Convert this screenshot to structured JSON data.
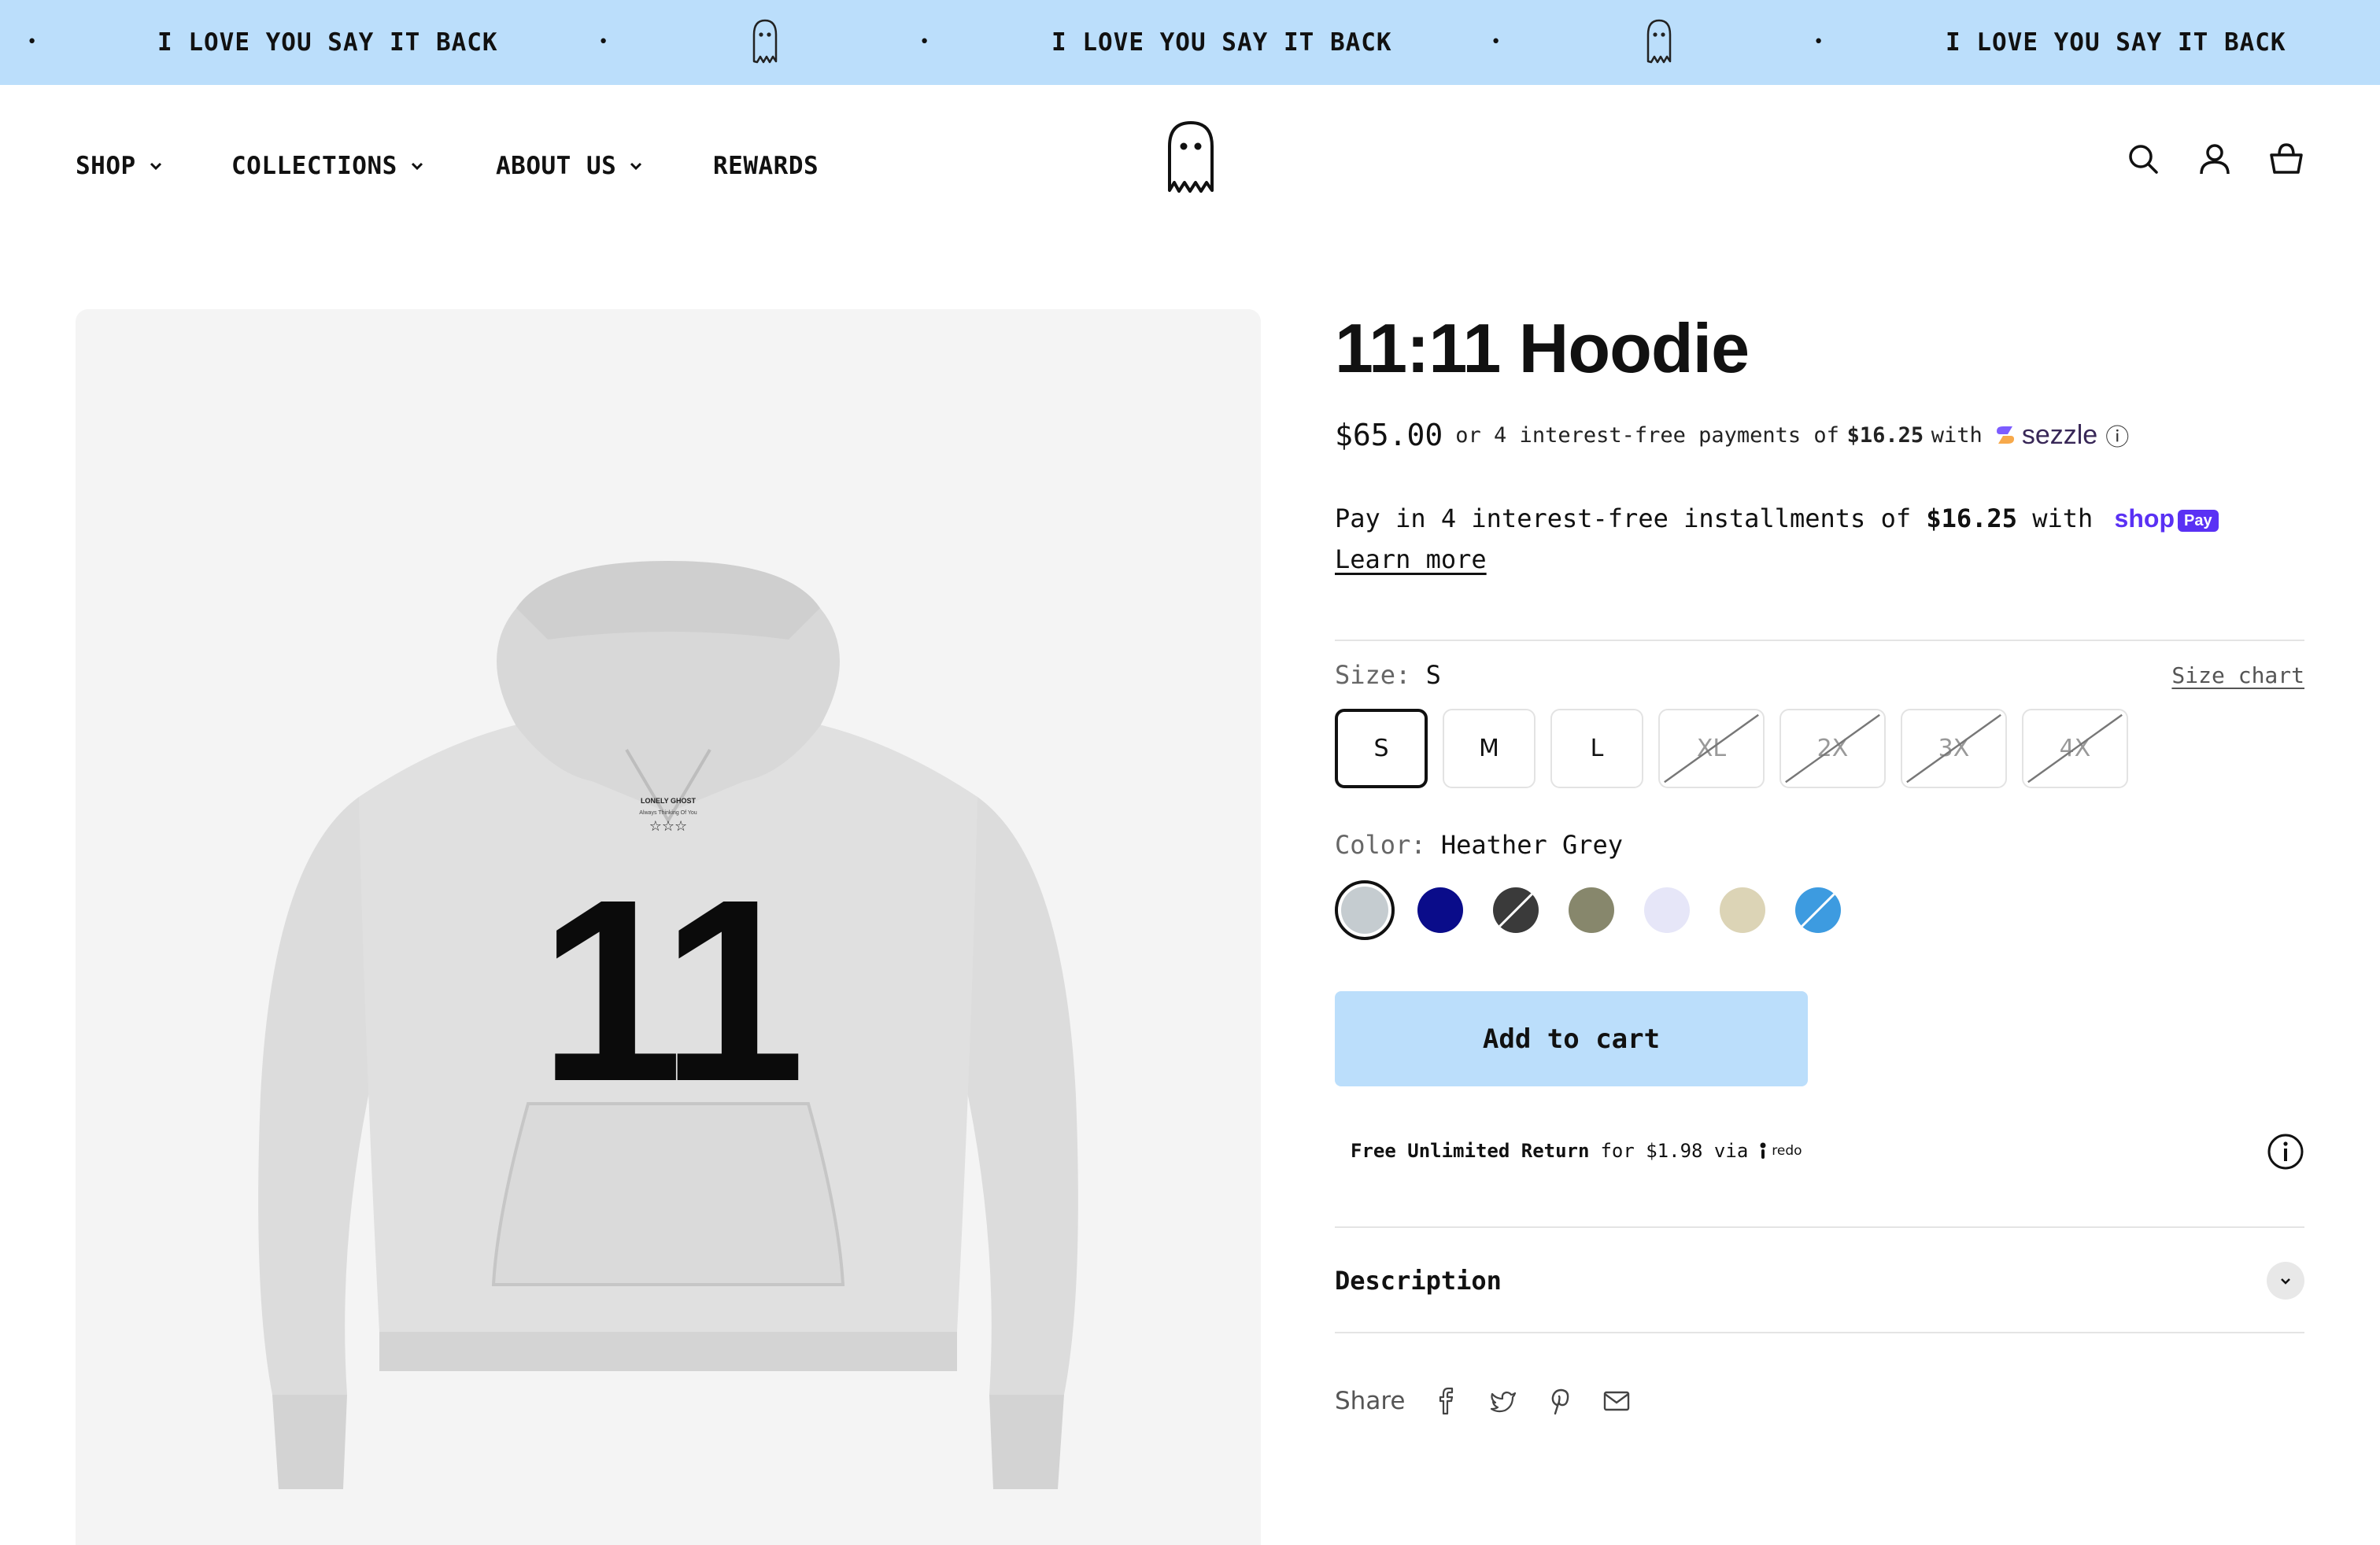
{
  "announcement": {
    "message": "I LOVE YOU SAY IT BACK",
    "separator": "•",
    "background": "#bbdefb"
  },
  "nav": {
    "items": [
      {
        "label": "SHOP",
        "has_dropdown": true
      },
      {
        "label": "COLLECTIONS",
        "has_dropdown": true
      },
      {
        "label": "ABOUT US",
        "has_dropdown": true
      },
      {
        "label": "REWARDS",
        "has_dropdown": false
      }
    ],
    "icons": [
      "ghost-logo-icon",
      "search-icon",
      "account-icon",
      "cart-icon"
    ]
  },
  "product": {
    "title": "11:11 Hoodie",
    "price": "$65.00",
    "image_print": {
      "brand": "LONELY GHOST",
      "tagline": "Always Thinking Of You",
      "number": "11"
    }
  },
  "sezzle": {
    "prefix": "or 4 interest-free payments of",
    "amount": "$16.25",
    "suffix": "with",
    "brand": "sezzle",
    "info_symbol": "ⓘ"
  },
  "shop_pay": {
    "prefix": "Pay in 4 interest-free installments of",
    "amount": "$16.25",
    "suffix": "with",
    "brand_word": "shop",
    "badge": "Pay",
    "learn_more": "Learn more"
  },
  "size": {
    "label": "Size:",
    "selected": "S",
    "size_chart": "Size chart",
    "options": [
      {
        "label": "S",
        "available": true,
        "selected": true
      },
      {
        "label": "M",
        "available": true,
        "selected": false
      },
      {
        "label": "L",
        "available": true,
        "selected": false
      },
      {
        "label": "XL",
        "available": false,
        "selected": false
      },
      {
        "label": "2X",
        "available": false,
        "selected": false
      },
      {
        "label": "3X",
        "available": false,
        "selected": false
      },
      {
        "label": "4X",
        "available": false,
        "selected": false
      }
    ]
  },
  "color": {
    "label": "Color:",
    "selected": "Heather Grey",
    "swatches": [
      {
        "hex": "#c5ccd0",
        "selected": true,
        "available": true
      },
      {
        "hex": "#0a0c8a",
        "selected": false,
        "available": true
      },
      {
        "hex": "#3a3a3a",
        "selected": false,
        "available": false
      },
      {
        "hex": "#87876c",
        "selected": false,
        "available": true
      },
      {
        "hex": "#e6e6f8",
        "selected": false,
        "available": true
      },
      {
        "hex": "#dcd4b6",
        "selected": false,
        "available": true
      },
      {
        "hex": "#3d9be0",
        "selected": false,
        "available": false
      }
    ]
  },
  "cart": {
    "add_label": "Add to cart",
    "button_color": "#bbdefb"
  },
  "redo": {
    "bold": "Free Unlimited Return",
    "text": "for $1.98 via",
    "brand": "redo"
  },
  "description": {
    "label": "Description"
  },
  "share": {
    "label": "Share",
    "icons": [
      "facebook-icon",
      "twitter-icon",
      "pinterest-icon",
      "email-icon"
    ]
  }
}
